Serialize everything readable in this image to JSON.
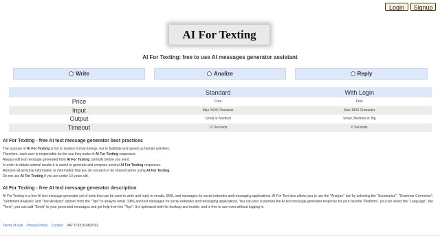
{
  "auth": {
    "login": "Login",
    "signup": "Signup"
  },
  "logo": "AI For Texting",
  "tagline": "AI For Texting: free to use AI messages generator assistant",
  "modes": [
    "Write",
    "Analize",
    "Reply"
  ],
  "table": {
    "headers": [
      "",
      "Standard",
      "With Login"
    ],
    "rows": [
      {
        "label": "Price",
        "standard": "Free",
        "login": "Free"
      },
      {
        "label": "Input",
        "standard": "Max 1500 Character",
        "login": "Max 1500 Character"
      },
      {
        "label": "Output",
        "standard": "Small or Medium",
        "login": "Small, Medium or Big"
      },
      {
        "label": "Timeout",
        "standard": "12 Seconds",
        "login": "6 Seconds"
      }
    ]
  },
  "practices": {
    "title": "AI For Texting - free AI text message generator best practices",
    "lines": [
      [
        "The purpose of ",
        "AI For Texting",
        " is not to replace human beings, but to facilitate and speed up human activities."
      ],
      [
        "Therefore, each user is responsible for the use they make of ",
        "AI For Texting",
        " responses."
      ],
      [
        "Always edit text message generated from ",
        "AI For Texting",
        " carefully before you send."
      ],
      [
        "In order to obtain optimal results it is useful to generate and compare several ",
        "AI For Texting",
        " responses."
      ],
      [
        "Remove all personal information or information that you do not wish to be shared before using ",
        "AI For Texting",
        "."
      ],
      [
        "Do not use ",
        "AI For Texting",
        " if you are under 13 years old."
      ]
    ]
  },
  "description": {
    "title": "AI For Texting - free AI text message generator description",
    "text": "AI For Texting is a free AI text message generator set of tools that can be used to write and reply to emails, SMS, and messages for social networks and messaging applications. AI For Text also allows you to use the \"Analyze\" tool by selecting the \"Summarize\", \"Grammar Correction\", \"Sentiment Analysis\" and \"Text Analysis\" options from the \"Tips\" to analyze email, SMS and text messages for social networks and messaging applications. You can also customize the AI text message generator response for your favorite \"Platform\", you can select the \"Language\", the \"Tone\", you can add \"Emoji\" to your generated messages and get help from the \"Tips\". It is optimized both for desktop and mobile, and is free to use even without logging in."
  },
  "footer": {
    "terms": "Terms of Use",
    "privacy": "Privacy Policy",
    "contact": "Contact",
    "vat": "VAT: IT03151450792"
  }
}
